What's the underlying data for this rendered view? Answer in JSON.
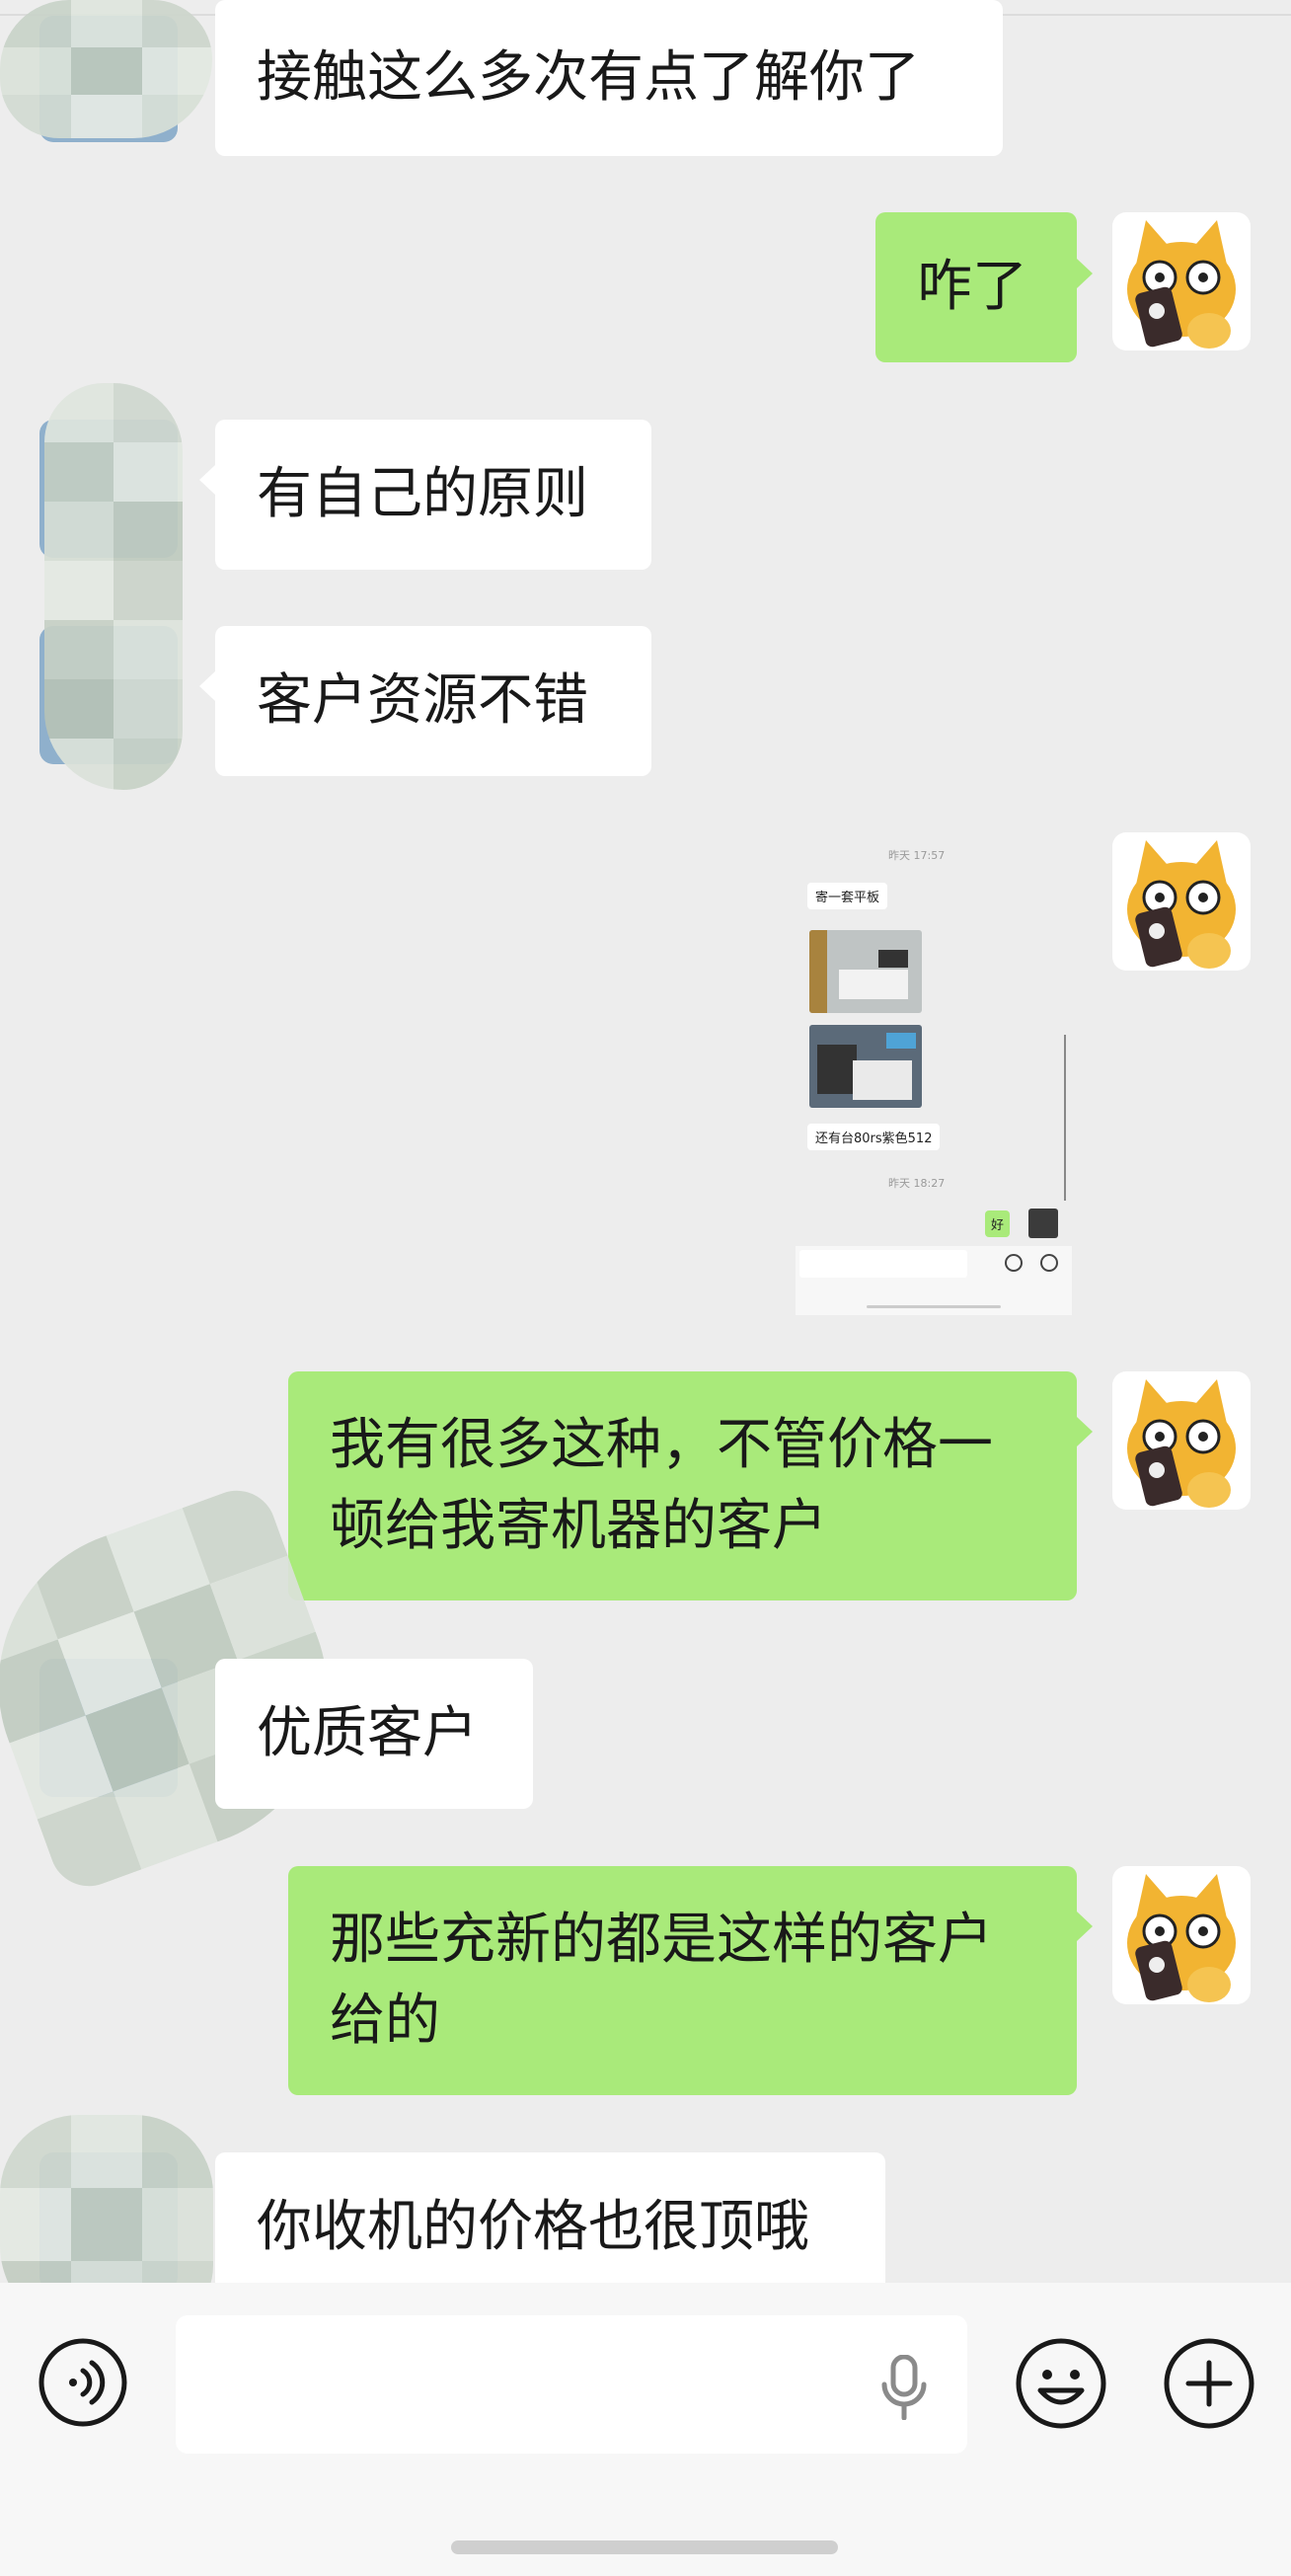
{
  "messages": [
    {
      "side": "in",
      "text": "接触这么多次有点了解你了"
    },
    {
      "side": "out",
      "text": "咋了"
    },
    {
      "side": "in",
      "text": "有自己的原则"
    },
    {
      "side": "in",
      "text": "客户资源不错"
    },
    {
      "side": "out",
      "type": "image"
    },
    {
      "side": "out",
      "text": "我有很多这种，不管价格一顿给我寄机器的客户"
    },
    {
      "side": "in",
      "text": "优质客户"
    },
    {
      "side": "out",
      "text": "那些充新的都是这样的客户给的"
    },
    {
      "side": "in",
      "text": "你收机的价格也很顶哦"
    }
  ],
  "embedded_screenshot": {
    "time1": "昨天 17:57",
    "msg1": "寄一套平板",
    "msg2": "还有台80rs紫色512",
    "time2": "昨天 18:27",
    "reply": "好"
  },
  "input_bar": {
    "voice_icon": "voice-icon",
    "mic_icon": "microphone-icon",
    "emoji_icon": "emoji-icon",
    "plus_icon": "plus-icon",
    "text": ""
  },
  "colors": {
    "background": "#ededed",
    "outgoing_bubble": "#a9ea7a",
    "incoming_bubble": "#ffffff"
  }
}
